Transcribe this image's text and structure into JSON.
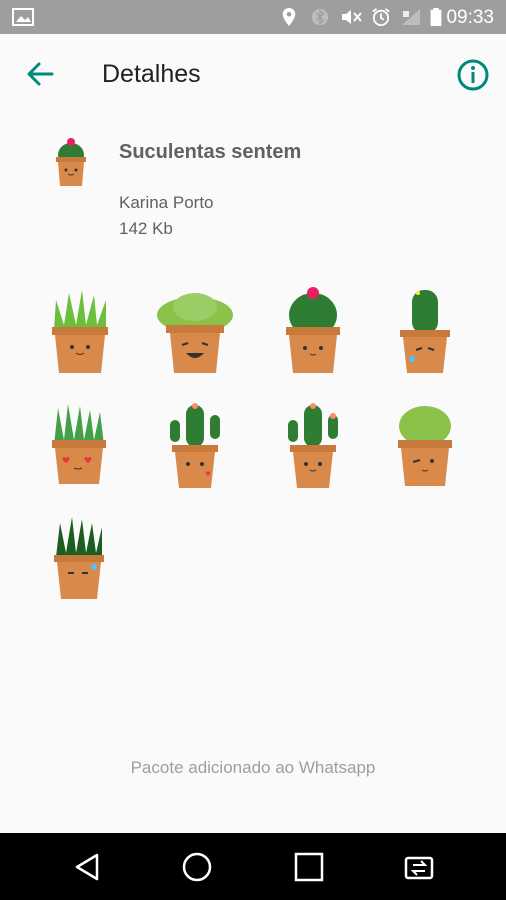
{
  "status_bar": {
    "time": "09:33"
  },
  "app_bar": {
    "title": "Detalhes"
  },
  "pack": {
    "name": "Suculentas sentem",
    "author": "Karina Porto",
    "size": "142 Kb"
  },
  "stickers": [
    "spiky-succulent",
    "rosette-succulent-smiling",
    "round-cactus-flower",
    "tall-cactus-sad",
    "grass-succulent-love",
    "arm-cactus-kiss",
    "arm-cactus-flowers",
    "rosette-winking",
    "dark-spiky-sweat"
  ],
  "footer": {
    "status": "Pacote adicionado ao Whatsapp"
  },
  "colors": {
    "accent": "#00897b",
    "pot": "#d98a4a",
    "plant": "#4caf50"
  }
}
